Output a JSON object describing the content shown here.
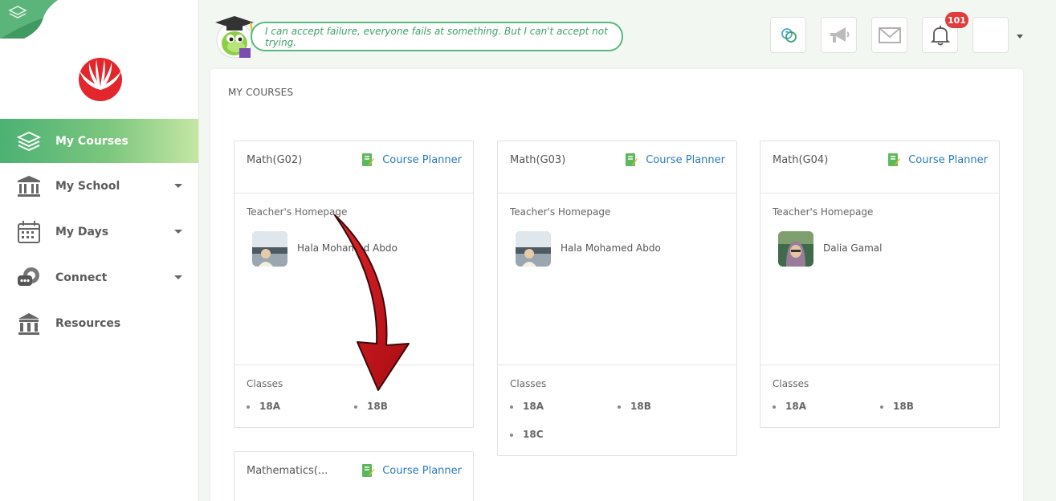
{
  "sidebar": {
    "items": [
      {
        "label": "My Courses",
        "icon": "stack-icon",
        "active": true,
        "has_caret": false
      },
      {
        "label": "My School",
        "icon": "school-building-icon",
        "active": false,
        "has_caret": true
      },
      {
        "label": "My Days",
        "icon": "calendar-icon",
        "active": false,
        "has_caret": true
      },
      {
        "label": "Connect",
        "icon": "chat-bubbles-icon",
        "active": false,
        "has_caret": true
      },
      {
        "label": "Resources",
        "icon": "library-icon",
        "active": false,
        "has_caret": false
      }
    ]
  },
  "header": {
    "quote": "I can accept failure, everyone fails at something. But I can't accept not trying.",
    "notification_count": "101",
    "icons": [
      "help-icon",
      "megaphone-icon",
      "mail-icon",
      "bell-icon"
    ]
  },
  "main": {
    "title": "MY COURSES",
    "planner_label": "Course Planner",
    "teacher_homepage_label": "Teacher's Homepage",
    "classes_label": "Classes",
    "courses": [
      {
        "title": "Math(G02)",
        "teacher": "Hala Mohamed Abdo",
        "classes": [
          "18A",
          "18B"
        ]
      },
      {
        "title": "Math(G03)",
        "teacher": "Hala Mohamed Abdo",
        "classes": [
          "18A",
          "18B",
          "18C"
        ]
      },
      {
        "title": "Math(G04)",
        "teacher": "Dalia Gamal",
        "classes": [
          "18A",
          "18B"
        ]
      },
      {
        "title": "Mathematics(...",
        "teacher": "",
        "classes": []
      }
    ]
  },
  "colors": {
    "accent_green": "#4cb174",
    "link_blue": "#2a7bbf",
    "badge_red": "#e23b3b",
    "annotation_arrow": "#c8141a"
  }
}
